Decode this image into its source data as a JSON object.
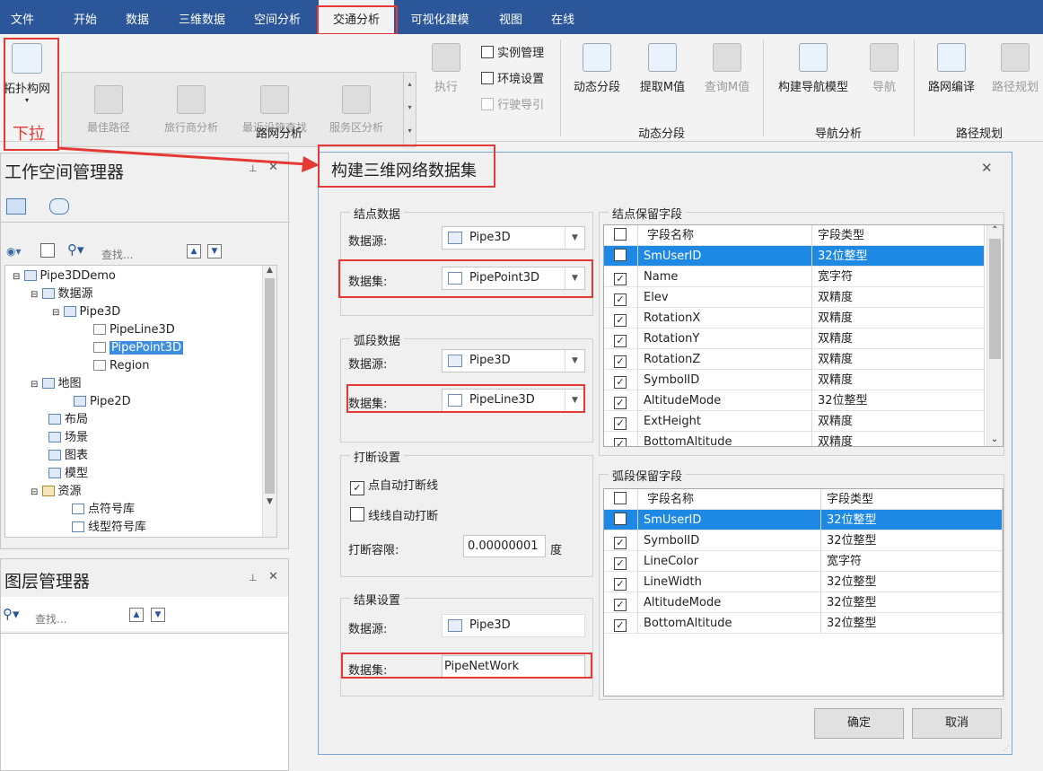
{
  "menu": [
    "文件",
    "开始",
    "数据",
    "三维数据",
    "空间分析",
    "交通分析",
    "可视化建模",
    "视图",
    "在线"
  ],
  "ribbon": {
    "topo_label": "拓扑构网",
    "annotation_dropdown": "下拉",
    "gallery": [
      "最佳路径",
      "旅行商分析",
      "最近设施查找",
      "服务区分析"
    ],
    "execute": "执行",
    "instance_mgmt": "实例管理",
    "env_settings": "环境设置",
    "drive_guide": "行驶导引",
    "group_network": "路网分析",
    "dynamic_seg": "动态分段",
    "extract_m": "提取M值",
    "query_m": "查询M值",
    "group_dynamic": "动态分段",
    "build_nav": "构建导航模型",
    "navigate": "导航",
    "group_nav": "导航分析",
    "compile_net": "路网编译",
    "route_plan": "路径规划",
    "group_route": "路径规划"
  },
  "workspace": {
    "title": "工作空间管理器",
    "search_placeholder": "查找...",
    "tree": [
      {
        "label": "Pipe3DDemo",
        "level": 0
      },
      {
        "label": "数据源",
        "level": 1
      },
      {
        "label": "Pipe3D",
        "level": 2
      },
      {
        "label": "PipeLine3D",
        "level": 3
      },
      {
        "label": "PipePoint3D",
        "level": 3,
        "selected": true
      },
      {
        "label": "Region",
        "level": 3
      },
      {
        "label": "地图",
        "level": 1
      },
      {
        "label": "Pipe2D",
        "level": 2
      },
      {
        "label": "布局",
        "level": 1
      },
      {
        "label": "场景",
        "level": 1
      },
      {
        "label": "图表",
        "level": 1
      },
      {
        "label": "模型",
        "level": 1
      },
      {
        "label": "资源",
        "level": 1
      },
      {
        "label": "点符号库",
        "level": 2
      },
      {
        "label": "线型符号库",
        "level": 2
      }
    ]
  },
  "layers": {
    "title": "图层管理器",
    "search_placeholder": "查找..."
  },
  "dialog": {
    "title": "构建三维网络数据集",
    "node_group": "结点数据",
    "datasource_label": "数据源:",
    "dataset_label": "数据集:",
    "node_datasource": "Pipe3D",
    "node_dataset": "PipePoint3D",
    "arc_group": "弧段数据",
    "arc_datasource": "Pipe3D",
    "arc_dataset": "PipeLine3D",
    "break_group": "打断设置",
    "auto_break_point": "点自动打断线",
    "auto_break_line": "线线自动打断",
    "tolerance_label": "打断容限:",
    "tolerance_value": "0.00000001",
    "tolerance_unit": "度",
    "result_group": "结果设置",
    "result_datasource": "Pipe3D",
    "result_dataset": "PipeNetWork",
    "node_fields_title": "结点保留字段",
    "arc_fields_title": "弧段保留字段",
    "col_name": "字段名称",
    "col_type": "字段类型",
    "node_fields": [
      {
        "name": "SmUserID",
        "type": "32位整型",
        "checked": false,
        "selected": true
      },
      {
        "name": "Name",
        "type": "宽字符",
        "checked": true
      },
      {
        "name": "Elev",
        "type": "双精度",
        "checked": true
      },
      {
        "name": "RotationX",
        "type": "双精度",
        "checked": true
      },
      {
        "name": "RotationY",
        "type": "双精度",
        "checked": true
      },
      {
        "name": "RotationZ",
        "type": "双精度",
        "checked": true
      },
      {
        "name": "SymbolID",
        "type": "双精度",
        "checked": true
      },
      {
        "name": "AltitudeMode",
        "type": "32位整型",
        "checked": true
      },
      {
        "name": "ExtHeight",
        "type": "双精度",
        "checked": true
      },
      {
        "name": "BottomAltitude",
        "type": "双精度",
        "checked": true
      }
    ],
    "arc_fields": [
      {
        "name": "SmUserID",
        "type": "32位整型",
        "checked": false,
        "selected": true
      },
      {
        "name": "SymbolID",
        "type": "32位整型",
        "checked": true
      },
      {
        "name": "LineColor",
        "type": "宽字符",
        "checked": true
      },
      {
        "name": "LineWidth",
        "type": "32位整型",
        "checked": true
      },
      {
        "name": "AltitudeMode",
        "type": "32位整型",
        "checked": true
      },
      {
        "name": "BottomAltitude",
        "type": "32位整型",
        "checked": true
      }
    ],
    "ok": "确定",
    "cancel": "取消"
  }
}
